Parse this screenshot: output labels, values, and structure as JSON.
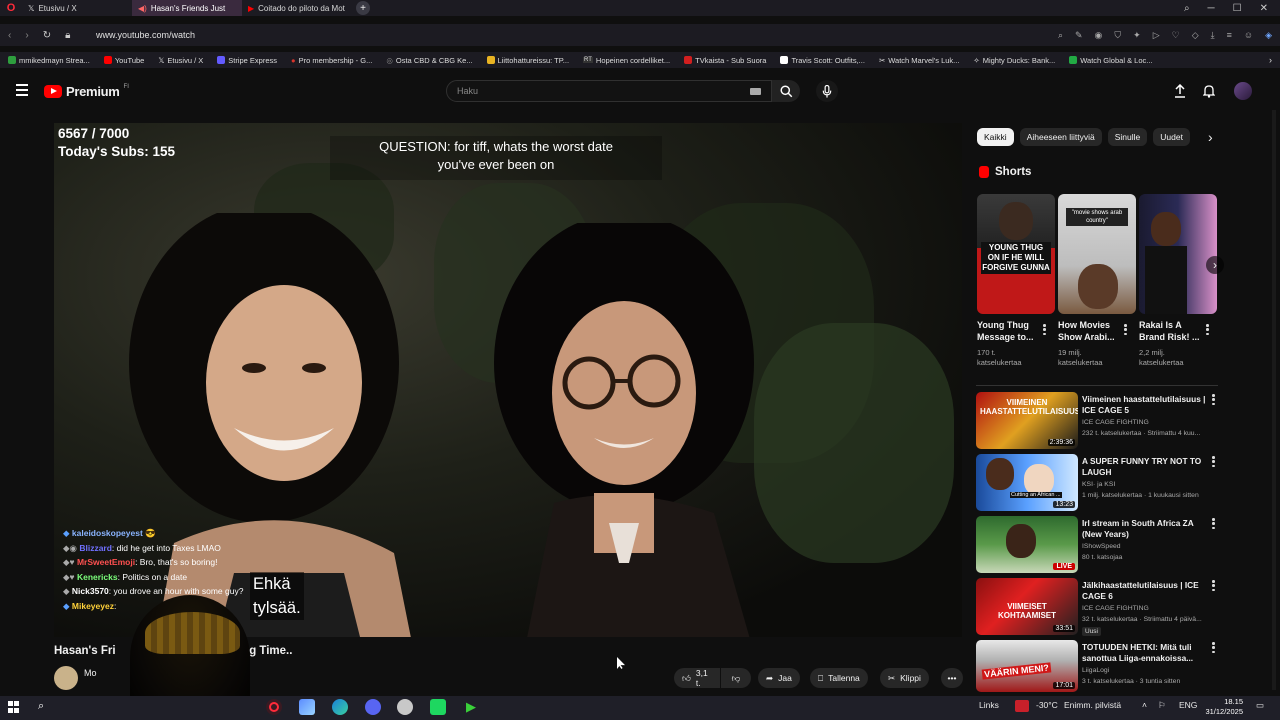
{
  "browser": {
    "tabs": [
      {
        "label": "Etusivu / X",
        "active": false
      },
      {
        "label": "Hasan's Friends Just",
        "active": true
      },
      {
        "label": "Coitado do piloto da Mot",
        "active": false
      }
    ],
    "url": "www.youtube.com/watch",
    "bookmarks": [
      {
        "label": "mmikedmayn Strea...",
        "color": "#2e9e3e"
      },
      {
        "label": "YouTube",
        "color": "#ff0000"
      },
      {
        "label": "Etusivu / X",
        "color": "#222222"
      },
      {
        "label": "Stripe Express",
        "color": "#635bff"
      },
      {
        "label": "Pro membership - G...",
        "color": "#d9342b"
      },
      {
        "label": "Osta CBD & CBG Ke...",
        "color": "#777777"
      },
      {
        "label": "Liittohattureissu: TP...",
        "color": "#e8b322"
      },
      {
        "label": "Hopeinen cordelliket...",
        "color": "#333333"
      },
      {
        "label": "TVkaista - Sub Suora",
        "color": "#d21f1f"
      },
      {
        "label": "Travis Scott: Outfits,...",
        "color": "#ffffff"
      },
      {
        "label": "Watch Marvel's Luk...",
        "color": "#aaaaaa"
      },
      {
        "label": "Mighty Ducks: Bank...",
        "color": "#cccccc"
      },
      {
        "label": "Watch Global & Loc...",
        "color": "#22aa44"
      }
    ]
  },
  "header": {
    "logo_text": "Premium",
    "logo_region": "FI",
    "search_placeholder": "Haku"
  },
  "video": {
    "overlay_counter": "6567 / 7000",
    "overlay_subs": "Today's Subs: 155",
    "question_line1": "QUESTION: for tiff, whats the worst date",
    "question_line2": "you've ever been on",
    "subtitle_line1": "Ehkä",
    "subtitle_line2": "tylsää.",
    "chat": [
      {
        "user": "kaleidoskopeyest",
        "text": ""
      },
      {
        "user": "Blizzard",
        "text": "did he get into Taxes LMAO"
      },
      {
        "user": "MrSweetEmoji",
        "text": "Bro, that's so boring!"
      },
      {
        "user": "Kenericks",
        "text": "Politics on a date"
      },
      {
        "user": "Nick3570",
        "text": "you drove an hour with some guy?"
      },
      {
        "user": "Mikeyeyez",
        "text": ""
      }
    ],
    "title_left": "Hasan's Fri",
    "title_right": "ig Time..",
    "channel_partial": "Mo",
    "actions": {
      "likes": "3,1 t.",
      "share": "Jaa",
      "save": "Tallenna",
      "clip": "Klippi"
    }
  },
  "sidebar": {
    "chips": [
      "Kaikki",
      "Aiheeseen liittyviä",
      "Sinulle",
      "Uudet"
    ],
    "shorts_heading": "Shorts",
    "shorts": [
      {
        "title": "Young Thug Message to...",
        "views": "170 t. katselukertaa",
        "thumb_text": "YOUNG THUG ON IF HE WILL FORGIVE GUNNA"
      },
      {
        "title": "How Movies Show Arabi...",
        "views": "19 milj. katselukertaa",
        "thumb_text": "\"movie shows arab country\""
      },
      {
        "title": "Rakai Is A Brand Risk! ...",
        "views": "2,2 milj. katselukertaa",
        "thumb_text": ""
      }
    ],
    "recommended": [
      {
        "title": "Viimeinen haastattelutilaisuus | ICE CAGE 5",
        "channel": "ICE CAGE FIGHTING",
        "meta": "232 t. katselukertaa · Striimattu 4 kuu...",
        "badge": "2:39:36",
        "live": false,
        "thumb_text": "VIIMEINEN HAASTATTELUTILAISUUS"
      },
      {
        "title": "A SUPER FUNNY TRY NOT TO LAUGH",
        "channel": "KSI· ja KSI",
        "meta": "1 milj. katselukertaa · 1 kuukausi sitten",
        "badge": "13:23",
        "live": false,
        "thumb_text": "Cutting an African ..."
      },
      {
        "title": "Irl stream in South Africa ZA (New Years)",
        "channel": "IShowSpeed",
        "meta": "80 t. katsojaa",
        "badge": "LIVE",
        "live": true,
        "thumb_text": ""
      },
      {
        "title": "Jälkihaastattelutilaisuus | ICE CAGE 6",
        "channel": "ICE CAGE FIGHTING",
        "meta": "32 t. katselukertaa · Striimattu 4 päivä...",
        "badge": "33:51",
        "live": false,
        "thumb_text": "VIIMEISET KOHTAAMISET",
        "tag": "Uusi"
      },
      {
        "title": "TOTUUDEN HETKI: Mitä tuli sanottua Liiga-ennakoissa...",
        "channel": "LiigaLogi",
        "meta": "3 t. katselukertaa · 3 tuntia sitten",
        "badge": "17:01",
        "live": false,
        "thumb_text": "VÄÄRIN MENI?"
      }
    ]
  },
  "taskbar": {
    "links_label": "Links",
    "weather": "-30°C",
    "weather_desc": "Enimm. pilvistä",
    "lang": "ENG",
    "time": "18.15",
    "date": "31/12/2025"
  }
}
